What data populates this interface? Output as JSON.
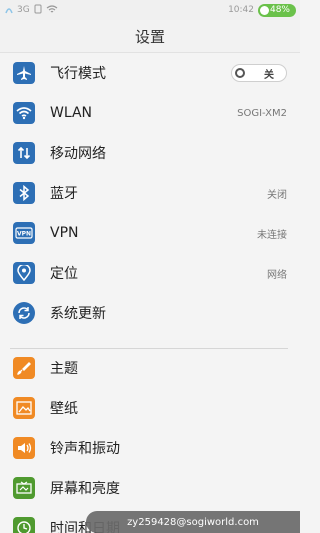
{
  "status_bar": {
    "network": "3G",
    "time": "10:42",
    "battery": "48%"
  },
  "header": {
    "title": "设置"
  },
  "settings": {
    "airplane": {
      "label": "飞行模式",
      "toggle": "关",
      "icon": "airplane-icon"
    },
    "wlan": {
      "label": "WLAN",
      "value": "SOGI-XM2",
      "icon": "wifi-icon"
    },
    "mobile": {
      "label": "移动网络",
      "icon": "mobile-data-icon"
    },
    "bluetooth": {
      "label": "蓝牙",
      "value": "关闭",
      "icon": "bluetooth-icon"
    },
    "vpn": {
      "label": "VPN",
      "value": "未连接",
      "icon": "vpn-icon"
    },
    "location": {
      "label": "定位",
      "value": "网络",
      "icon": "location-icon"
    },
    "update": {
      "label": "系统更新",
      "icon": "sync-icon"
    },
    "theme": {
      "label": "主题",
      "icon": "theme-icon"
    },
    "wallpaper": {
      "label": "壁纸",
      "icon": "wallpaper-icon"
    },
    "sound": {
      "label": "铃声和振动",
      "icon": "sound-icon"
    },
    "display": {
      "label": "屏幕和亮度",
      "icon": "display-icon"
    },
    "datetime": {
      "label": "时间和日期",
      "icon": "clock-icon"
    }
  },
  "toast": {
    "text": "zy259428@sogiworld.com"
  },
  "colors": {
    "blue_icon": "#2d6fb5",
    "orange_icon": "#f08a24",
    "green_icon": "#4f9a2f"
  }
}
